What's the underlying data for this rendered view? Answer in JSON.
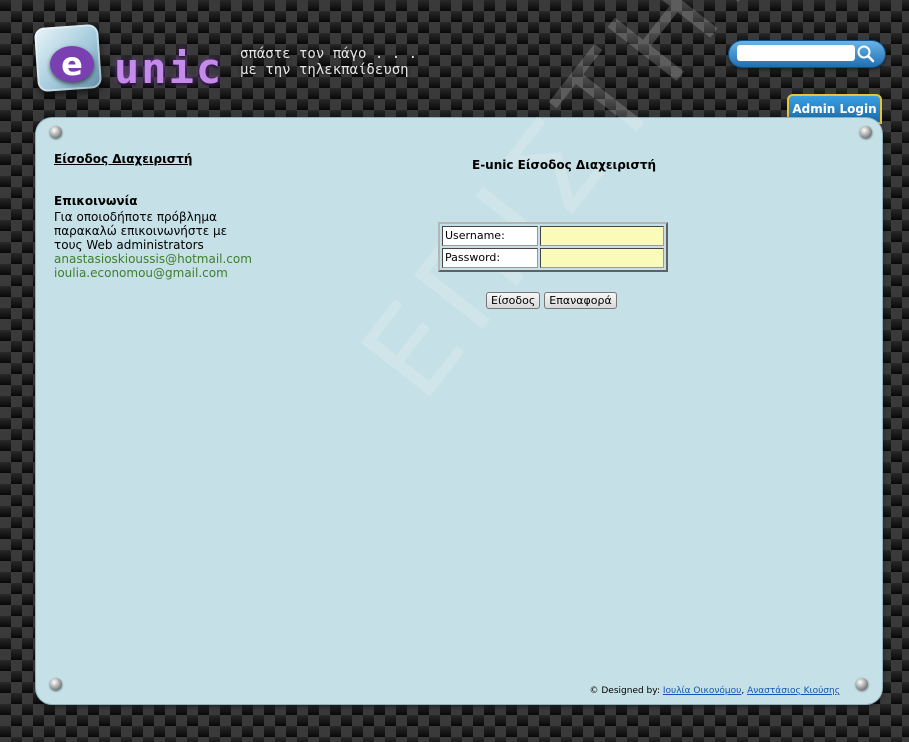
{
  "header": {
    "logo_letter": "e",
    "logo_text": "unic",
    "slogan_line1": "σπάστε τον πάγο . . .",
    "slogan_line2": "με την τηλεκπαίδευση",
    "search_placeholder": "",
    "admin_tab_label": "Admin Login"
  },
  "sidebar": {
    "title": "Είσοδος Διαχειριστή",
    "contact_heading": "Επικοινωνία",
    "contact_text_1": "Για οποιοδήποτε πρόβλημα",
    "contact_text_2": "παρακαλώ επικοινωνήστε με",
    "contact_text_3": "τους Web administrators",
    "email_1": "anastasioskioussis@hotmail.com",
    "email_2": "ioulia.economou@gmail.com"
  },
  "main": {
    "title": "E-unic Είσοδος Διαχειριστή",
    "username_label": "Username:",
    "password_label": "Password:",
    "username_value": "",
    "password_value": "",
    "submit_label": "Είσοδος",
    "reset_label": "Επαναφορά"
  },
  "footer": {
    "prefix": "© Designed by:",
    "author_1": "Ιουλία Οικονόμου",
    "separator": ",",
    "author_2": "Αναστάσιος Κιούσης"
  },
  "watermark": "ΕΠΙΣΤΗΜΟ",
  "colors": {
    "panel_bg": "#c5e0e6",
    "accent_blue": "#1f6fb2",
    "email_green": "#3e7f2e",
    "input_yellow": "#fbfbb9"
  }
}
